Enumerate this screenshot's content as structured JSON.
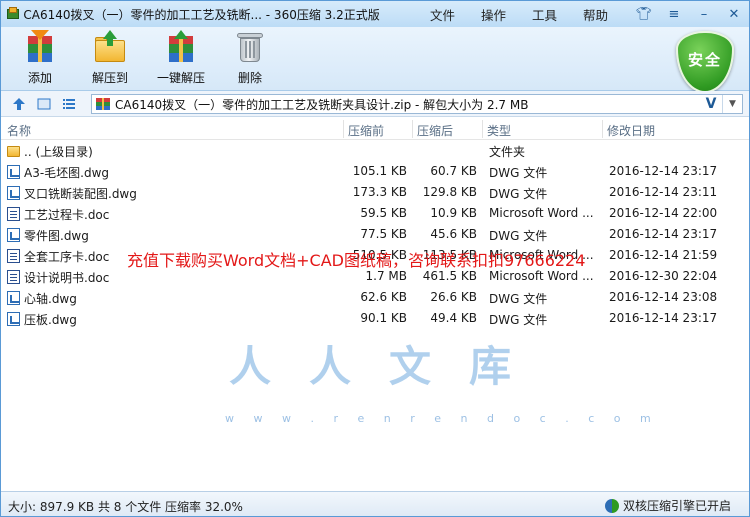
{
  "window": {
    "title": "CA6140拨叉（一）零件的加工工艺及铣断... - 360压缩 3.2正式版",
    "menu": [
      "文件",
      "操作",
      "工具",
      "帮助"
    ]
  },
  "toolbar": {
    "items": [
      {
        "label": "添加",
        "icon": "add-archive-icon"
      },
      {
        "label": "解压到",
        "icon": "extract-to-icon"
      },
      {
        "label": "一键解压",
        "icon": "one-click-extract-icon"
      },
      {
        "label": "删除",
        "icon": "trash-icon"
      }
    ],
    "security_badge": "安全"
  },
  "address": {
    "path": "CA6140拨叉（一）零件的加工工艺及铣断夹具设计.zip - 解包大小为 2.7 MB",
    "v_label": "V"
  },
  "columns": [
    "名称",
    "压缩前",
    "压缩后",
    "类型",
    "修改日期"
  ],
  "files": [
    {
      "name": ".. (上级目录)",
      "before": "",
      "after": "",
      "type": "文件夹",
      "date": "",
      "icon": "folder"
    },
    {
      "name": "A3-毛坯图.dwg",
      "before": "105.1 KB",
      "after": "60.7 KB",
      "type": "DWG 文件",
      "date": "2016-12-14 23:17",
      "icon": "dwg"
    },
    {
      "name": "叉口铣断装配图.dwg",
      "before": "173.3 KB",
      "after": "129.8 KB",
      "type": "DWG 文件",
      "date": "2016-12-14 23:11",
      "icon": "dwg"
    },
    {
      "name": "工艺过程卡.doc",
      "before": "59.5 KB",
      "after": "10.9 KB",
      "type": "Microsoft Word ...",
      "date": "2016-12-14 22:00",
      "icon": "doc"
    },
    {
      "name": "零件图.dwg",
      "before": "77.5 KB",
      "after": "45.6 KB",
      "type": "DWG 文件",
      "date": "2016-12-14 23:17",
      "icon": "dwg"
    },
    {
      "name": "全套工序卡.doc",
      "before": "510.5 KB",
      "after": "113.5 KB",
      "type": "Microsoft Word ...",
      "date": "2016-12-14 21:59",
      "icon": "doc"
    },
    {
      "name": "设计说明书.doc",
      "before": "1.7 MB",
      "after": "461.5 KB",
      "type": "Microsoft Word ...",
      "date": "2016-12-30 22:04",
      "icon": "doc"
    },
    {
      "name": "心轴.dwg",
      "before": "62.6 KB",
      "after": "26.6 KB",
      "type": "DWG 文件",
      "date": "2016-12-14 23:08",
      "icon": "dwg"
    },
    {
      "name": "压板.dwg",
      "before": "90.1 KB",
      "after": "49.4 KB",
      "type": "DWG 文件",
      "date": "2016-12-14 23:17",
      "icon": "dwg"
    }
  ],
  "watermark": {
    "ad_text": "充值下载购买Word文档+CAD图纸稿，咨询联系扣扣97666224",
    "logo": "人人文库",
    "url": "w w w . r e n r e n d o c . c o m"
  },
  "status": {
    "summary": "大小: 897.9 KB 共 8 个文件 压缩率 32.0%",
    "engine": "双核压缩引擎已开启"
  },
  "colors": {
    "accent": "#5a9ad6",
    "watermark_red": "#e31818",
    "security_green": "#2f9a22"
  }
}
